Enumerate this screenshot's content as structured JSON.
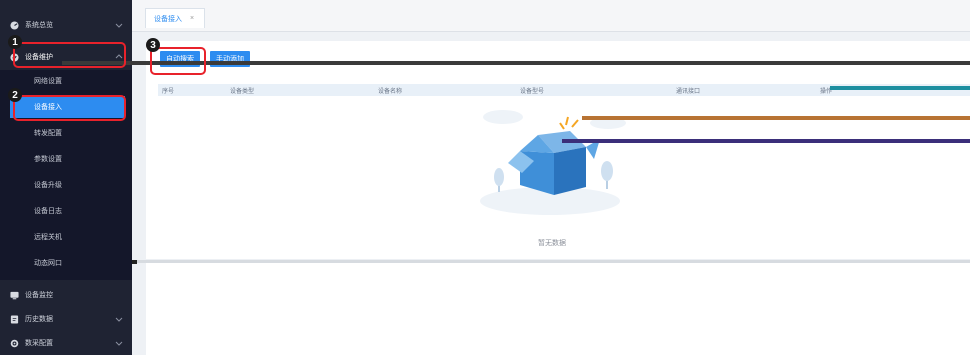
{
  "sidebar": {
    "menus": [
      {
        "label": "系统总览",
        "icon": "dashboard-icon"
      },
      {
        "label": "设备维护",
        "icon": "settings-icon"
      },
      {
        "label": "设备监控",
        "icon": "monitor-icon"
      },
      {
        "label": "历史数据",
        "icon": "document-icon"
      },
      {
        "label": "数采配置",
        "icon": "gear-icon"
      }
    ],
    "submenu": [
      "网络设置",
      "设备接入",
      "转发配置",
      "参数设置",
      "设备升级",
      "设备日志",
      "远程关机",
      "动态网口"
    ],
    "active_submenu": "设备接入"
  },
  "tabs": [
    {
      "label": "设备接入",
      "close": "×"
    }
  ],
  "toolbar": {
    "auto_search": "自动搜索",
    "manual_add": "手动添加"
  },
  "table": {
    "columns": [
      "序号",
      "设备类型",
      "设备名称",
      "设备型号",
      "通讯接口",
      "操作"
    ],
    "empty_text": "暂无数据"
  },
  "annotations": [
    "1",
    "2",
    "3"
  ],
  "colors": {
    "sidebar": "#1f2333",
    "accent": "#2d8cf0",
    "annotation": "#e8222b"
  }
}
